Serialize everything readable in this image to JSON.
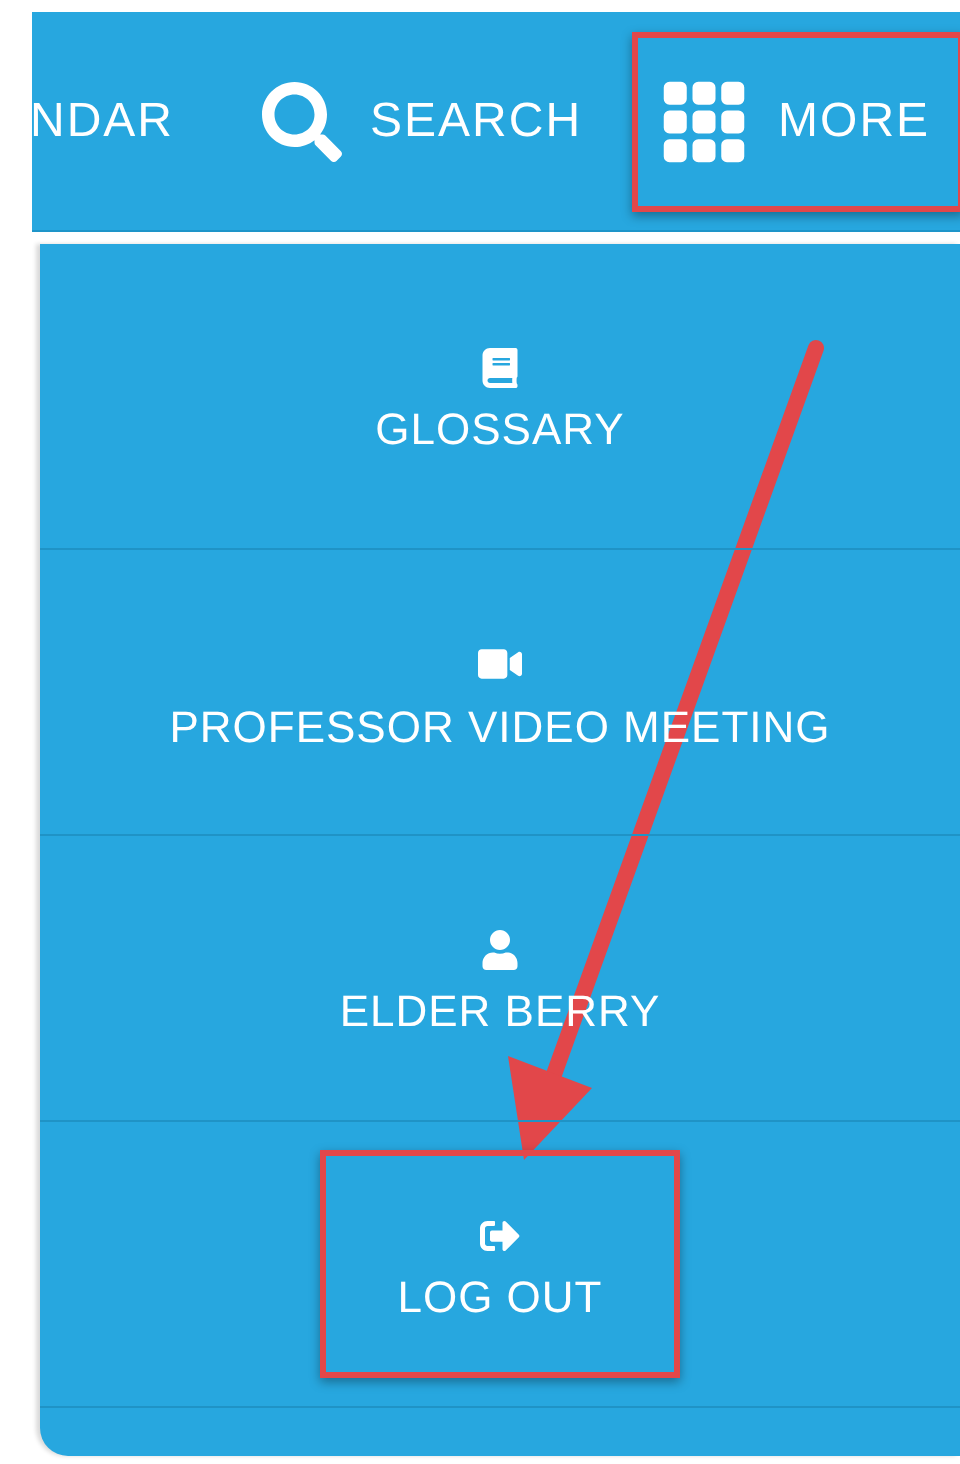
{
  "nav": [
    {
      "label": "NDAR",
      "kind": "text",
      "highlighted": false
    },
    {
      "label": "SEARCH",
      "kind": "search",
      "highlighted": false
    },
    {
      "label": "MORE",
      "kind": "grid",
      "highlighted": true
    }
  ],
  "menu": [
    {
      "label": "GLOSSARY",
      "kind": "book",
      "highlighted": false
    },
    {
      "label": "PROFESSOR VIDEO MEETING",
      "kind": "video",
      "highlighted": false
    },
    {
      "label": "ELDER BERRY",
      "kind": "user",
      "highlighted": false
    },
    {
      "label": "LOG OUT",
      "kind": "logout",
      "highlighted": true
    }
  ]
}
